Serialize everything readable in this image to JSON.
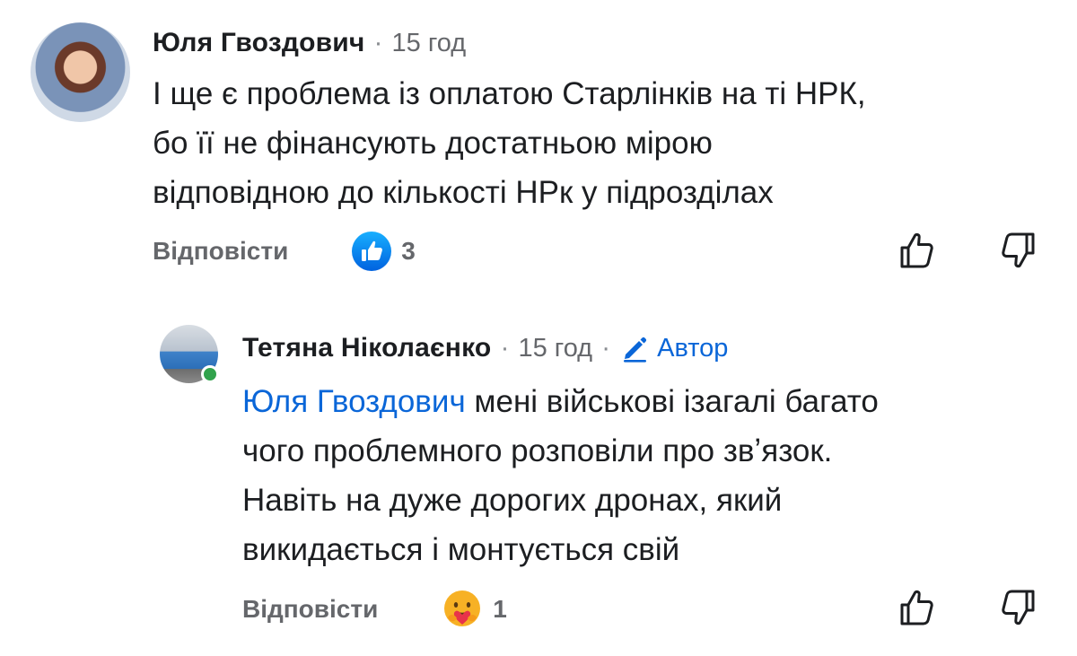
{
  "comments": [
    {
      "author": "Юля Гвоздович",
      "separator": "·",
      "time": "15 год",
      "text_lines": [
        "І ще є проблема із оплатою Старлінків на ті НРК,",
        "бо її не фінансують достатньою мірою",
        "відповідною до кількості НРк у підрозділах"
      ],
      "reply_label": "Відповісти",
      "reaction_icon": "like-reaction-icon",
      "reaction_count": "3"
    },
    {
      "author": "Тетяна Ніколаєнко",
      "separator": "·",
      "time": "15 год",
      "separator2": "·",
      "badge": "Автор",
      "badge_icon": "pencil-icon",
      "mention": "Юля Гвоздович",
      "text_lines": [
        " мені військові ізагалі багато",
        "чого проблемного розповіли про звʼязок.",
        "Навіть на дуже дорогих дронах, який",
        "викидається і монтується свій"
      ],
      "reply_label": "Відповісти",
      "reaction_icon": "care-reaction-icon",
      "reaction_count": "1"
    }
  ],
  "colors": {
    "accent": "#0a66d8",
    "secondary_text": "#65676b",
    "online": "#31a24c"
  }
}
